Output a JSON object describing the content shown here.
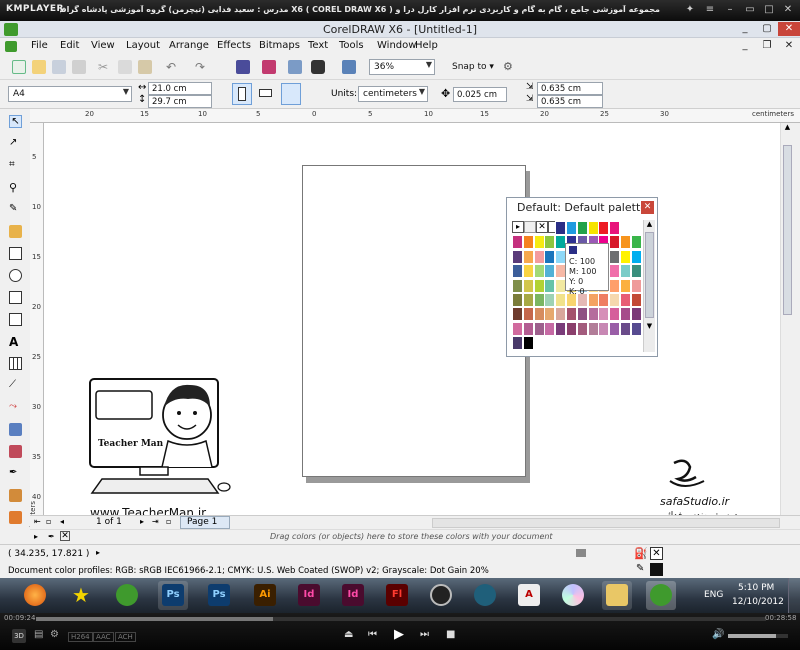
{
  "player": {
    "logo": "KMPLAYER",
    "title": "مجموعه آموزشی جامع ، گام به گام و کاربردی نرم افزار کارل درا و X6 ( COREL DRAW X6 )   مدرس : سعید فدایی (تیچرمن) گروه آموزشی پادشاه گرافیست ها",
    "time_elapsed": "00:09:24",
    "time_total": "00:28:58",
    "badge": "3D",
    "modes": [
      "H264",
      "AAC",
      "ACH"
    ]
  },
  "window": {
    "title": "CorelDRAW X6 - [Untitled-1]"
  },
  "menu": [
    "File",
    "Edit",
    "View",
    "Layout",
    "Arrange",
    "Effects",
    "Bitmaps",
    "Text",
    "Tools",
    "Window",
    "Help"
  ],
  "toolbar": {
    "zoom": "36%",
    "snap_label": "Snap to"
  },
  "property_bar": {
    "page_size": "A4",
    "width": "21.0 cm",
    "height": "29.7 cm",
    "units_label": "Units:",
    "units": "centimeters",
    "nudge": "0.025 cm",
    "dup_x": "0.635 cm",
    "dup_y": "0.635 cm"
  },
  "ruler": {
    "h_labels": [
      "20",
      "15",
      "10",
      "5",
      "0",
      "5",
      "10",
      "15",
      "20",
      "25",
      "30"
    ],
    "h_unit": "centimeters",
    "v_labels": [
      "5",
      "10",
      "15",
      "20",
      "25",
      "30",
      "35",
      "40"
    ],
    "v_unit": "centimeters"
  },
  "palette": {
    "title": "Default: Default palette",
    "tooltip": [
      "C: 100",
      "M: 100",
      "Y: 0",
      "K: 0"
    ],
    "colors": [
      [
        "#2a2e86",
        "#1f9be0",
        "#22a24a",
        "#f6e300",
        "#ed1c24",
        "#e8147b"
      ],
      [
        "#c4307e",
        "#f58220",
        "#f6eb13",
        "#8cc63f",
        "#00a99d",
        "#2e3192",
        "#6a59a6",
        "#9b59b6",
        "#ec008c",
        "#d7182a",
        "#f7941d",
        "#39b54a"
      ],
      [
        "#5a3b7a",
        "#f7a84e",
        "#f49c9e",
        "#1b75bc",
        "#8ed8f8",
        "#c2b59b",
        "#754c24",
        "#a67c52",
        "#bcbec0",
        "#6d6e71",
        "#fff200",
        "#00aeef"
      ],
      [
        "#3c5e9a",
        "#f9d342",
        "#a3d977",
        "#52b1d6",
        "#f6b8a6",
        "#e97a4f",
        "#c69c6d",
        "#8781bd",
        "#bd8cbf",
        "#f06eaa",
        "#7accc8",
        "#3a8f7d"
      ],
      [
        "#7f8f4a",
        "#d2c64c",
        "#b2d235",
        "#66c3a8",
        "#f2e9a1",
        "#e3d15f",
        "#98c1d9",
        "#ffe08a",
        "#ffd29e",
        "#ff9f6b",
        "#fbb040",
        "#ef9a9a"
      ],
      [
        "#7b7d3a",
        "#a7a945",
        "#7bb661",
        "#9ed2b4",
        "#f1e28b",
        "#f8d46f",
        "#e5b8b5",
        "#f4a261",
        "#ee7d62",
        "#f6d8ae",
        "#e85d75",
        "#c34a36"
      ],
      [
        "#6e3b2d",
        "#c5674c",
        "#d68c5e",
        "#e6a86e",
        "#d9a79c",
        "#a4506d",
        "#8e4f83",
        "#b56d9d",
        "#d68fb8",
        "#d65f9b",
        "#a64b8a",
        "#7b3a78"
      ],
      [
        "#d16a9e",
        "#b35d92",
        "#9d5f8c",
        "#c66aa4",
        "#7a3c7a",
        "#8b3f6c",
        "#a35c7d",
        "#b27d98",
        "#c888b4",
        "#9a5ea7",
        "#6a4b8a",
        "#574b90"
      ],
      [
        "#4a3a6a",
        "#000000"
      ]
    ]
  },
  "canvas": {
    "teacherman_url": "www.TeacherMan.ir",
    "teacherman_label": "Teacher Man",
    "safa_url": "safaStudio.ir",
    "safa_caption": "مدرس: مهندس فدائی"
  },
  "doc_nav": {
    "page_counter": "1 of 1",
    "page_tab": "Page 1",
    "drop_hint": "Drag colors (or objects) here to store these colors with your document"
  },
  "status": {
    "coords": "( 34.235, 17.821 )",
    "profiles": "Document color profiles: RGB: sRGB IEC61966-2.1; CMYK: U.S. Web Coated (SWOP) v2; Grayscale: Dot Gain 20%"
  },
  "taskbar": {
    "apps": [
      "firefox",
      "star",
      "coreldraw",
      "Ps",
      "Ps",
      "Ai",
      "Id",
      "Id",
      "Fl",
      "corel-capture",
      "corel-connect",
      "acrobat",
      "dvd",
      "explorer",
      "coreldraw"
    ],
    "lang": "ENG",
    "time": "5:10 PM",
    "date": "12/10/2012"
  }
}
